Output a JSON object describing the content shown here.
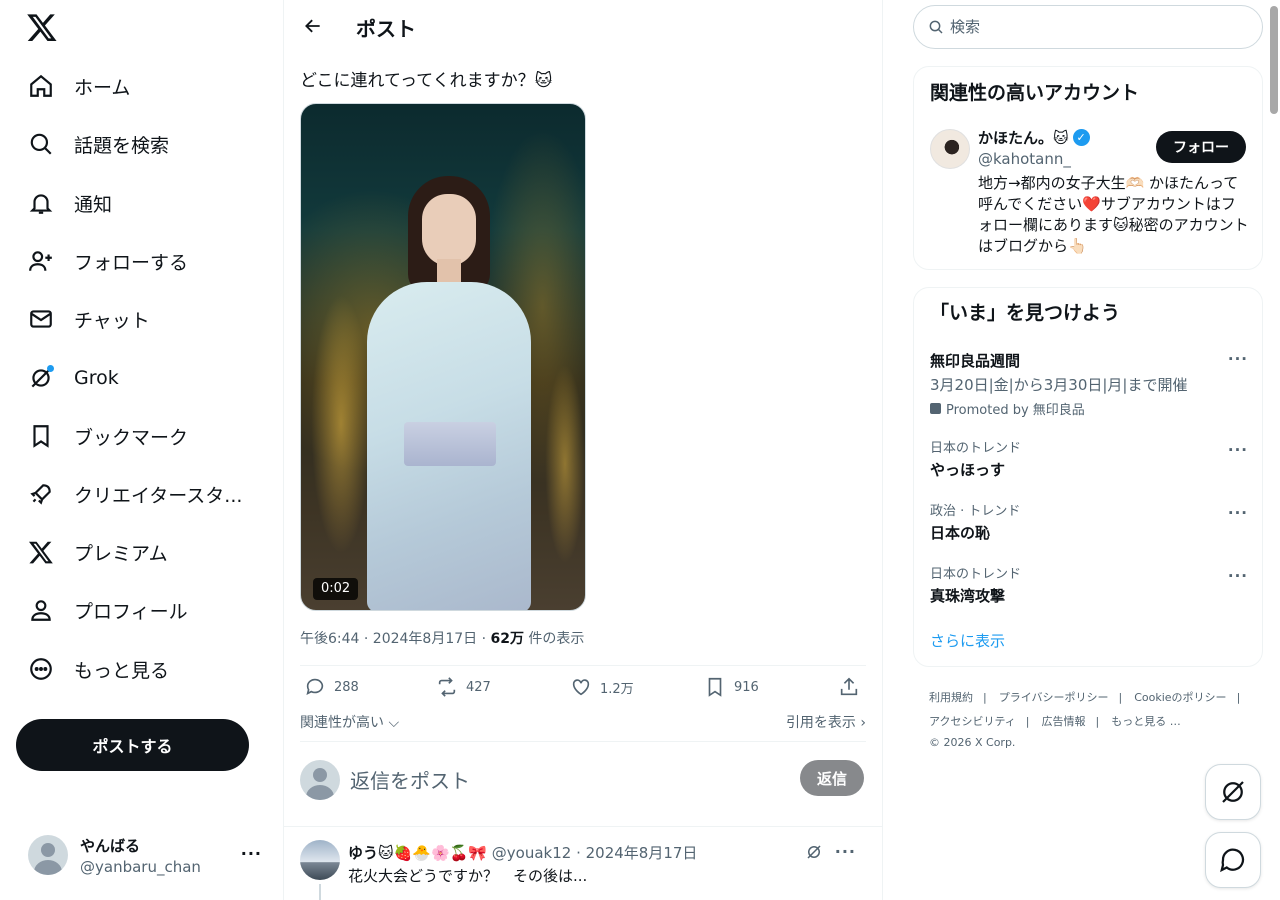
{
  "nav": {
    "logo": "X",
    "items": [
      {
        "label": "ホーム",
        "icon": "home-icon"
      },
      {
        "label": "話題を検索",
        "icon": "search-icon"
      },
      {
        "label": "通知",
        "icon": "bell-icon"
      },
      {
        "label": "フォローする",
        "icon": "add-user-icon"
      },
      {
        "label": "チャット",
        "icon": "mail-icon"
      },
      {
        "label": "Grok",
        "icon": "grok-icon"
      },
      {
        "label": "ブックマーク",
        "icon": "bookmark-icon"
      },
      {
        "label": "クリエイタースタ...",
        "icon": "rocket-icon"
      },
      {
        "label": "プレミアム",
        "icon": "x-icon"
      },
      {
        "label": "プロフィール",
        "icon": "person-icon"
      },
      {
        "label": "もっと見る",
        "icon": "more-circle-icon"
      }
    ],
    "post_button": "ポストする",
    "account": {
      "name": "やんばる",
      "handle": "@yanbaru_chan",
      "more": "···"
    }
  },
  "main": {
    "header_title": "ポスト",
    "tweet": {
      "text": "どこに連れてってくれますか？🐱",
      "video_time": "0:02",
      "meta_time": "午後6:44 · 2024年8月17日 · ",
      "views_count": "62万",
      "views_label": " 件の表示",
      "replies": "288",
      "retweets": "427",
      "likes": "1.2万",
      "bookmarks": "916"
    },
    "sort_label": "関連性が高い",
    "quotes_label": "引用を表示",
    "reply_placeholder": "返信をポスト",
    "reply_button": "返信",
    "first_reply": {
      "name": "ゆう🐱🍓🐣🌸🍒🎀",
      "meta": " @youak12 · 2024年8月17日",
      "text": "花火大会どうですか？　その後は..."
    }
  },
  "sidebar": {
    "search_placeholder": "検索",
    "relevant": {
      "title": "関連性の高いアカウント",
      "name": "かほたん。🐱",
      "handle": "@kahotann_",
      "follow": "フォロー",
      "bio": "地方→都内の女子大生🫶🏻 かほたんって呼んでください❤️サブアカウントはフォロー欄にあります🐱秘密のアカウントはブログから👆🏻"
    },
    "trends": {
      "title": "「いま」を見つけよう",
      "promoted": {
        "name": "無印良品週間",
        "sub": "3月20日|金|から3月30日|月|まで開催",
        "promo": "Promoted by 無印良品"
      },
      "items": [
        {
          "context": "日本のトレンド",
          "name": "やっほっす"
        },
        {
          "context": "政治 · トレンド",
          "name": "日本の恥"
        },
        {
          "context": "日本のトレンド",
          "name": "真珠湾攻撃"
        }
      ],
      "more_menu": "···",
      "show_more": "さらに表示"
    },
    "footer": {
      "links": [
        "利用規約",
        "プライバシーポリシー",
        "Cookieのポリシー",
        "アクセシビリティ",
        "広告情報",
        "もっと見る …"
      ],
      "separator": "|",
      "copyright": "© 2026 X Corp."
    }
  },
  "colors": {
    "accent": "#1d9bf0",
    "text": "#0f1419",
    "muted": "#536471",
    "border": "#eff3f4"
  }
}
